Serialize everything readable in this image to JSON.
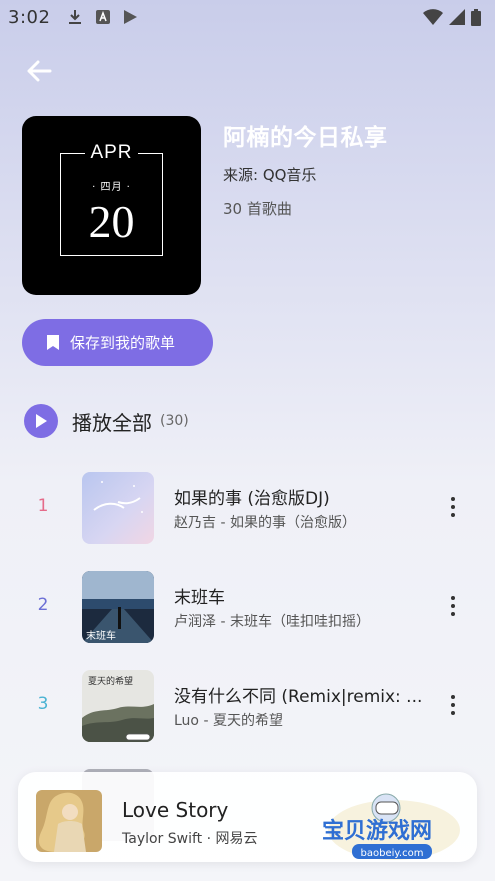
{
  "status_bar": {
    "time": "3:02"
  },
  "header": {
    "back_icon": "arrow-left-icon"
  },
  "cover": {
    "month": "APR",
    "cn_month": "· 四月 ·",
    "day": "20"
  },
  "playlist": {
    "title": "阿楠的今日私享",
    "source": "来源: QQ音乐",
    "count": "30 首歌曲"
  },
  "save_button": {
    "label": "保存到我的歌单",
    "icon": "bookmark-icon"
  },
  "play_all": {
    "label": "播放全部",
    "count": "(30)"
  },
  "songs": [
    {
      "index": "1",
      "title": "如果的事 (治愈版DJ)",
      "subtitle": "赵乃吉 - 如果的事（治愈版）",
      "index_color": "#e56b8a"
    },
    {
      "index": "2",
      "title": "末班车",
      "subtitle": "卢润泽 - 末班车（哇扣哇扣摇）",
      "index_color": "#6b6fd6",
      "art_text": "末班车"
    },
    {
      "index": "3",
      "title": "没有什么不同 (Remix|remix: ...",
      "subtitle": "Luo - 夏天的希望",
      "index_color": "#4bb3d3",
      "art_text": "夏天的希望"
    }
  ],
  "now_playing": {
    "title": "Love Story",
    "subtitle": "Taylor Swift · 网易云"
  },
  "watermark": {
    "text": "宝贝游戏网",
    "url": "baobeiy.com"
  },
  "colors": {
    "accent": "#7e6de4"
  }
}
